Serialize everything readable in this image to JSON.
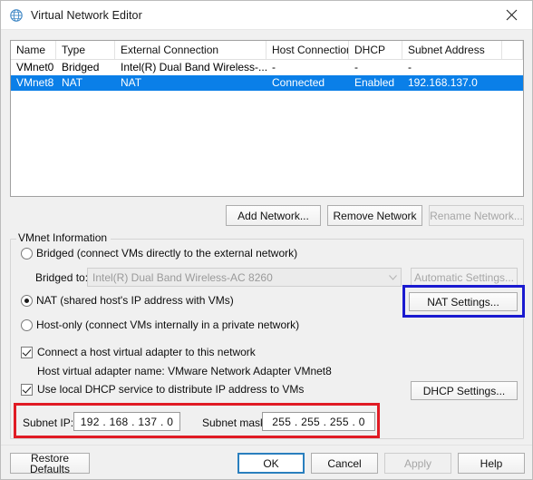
{
  "window": {
    "title": "Virtual Network Editor",
    "icon": "network-globe-icon",
    "close_label": "✕"
  },
  "network_list": {
    "columns": [
      "Name",
      "Type",
      "External Connection",
      "Host Connection",
      "DHCP",
      "Subnet Address"
    ],
    "rows": [
      {
        "name": "VMnet0",
        "type": "Bridged",
        "external": "Intel(R) Dual Band Wireless-...",
        "host": "-",
        "dhcp": "-",
        "subnet": "-",
        "selected": false
      },
      {
        "name": "VMnet8",
        "type": "NAT",
        "external": "NAT",
        "host": "Connected",
        "dhcp": "Enabled",
        "subnet": "192.168.137.0",
        "selected": true
      }
    ],
    "selection_color": "#0a7fe8"
  },
  "list_buttons": {
    "add": "Add Network...",
    "remove": "Remove Network",
    "rename": "Rename Network..."
  },
  "vmnet_info": {
    "group_title": "VMnet Information",
    "bridged_option": "Bridged (connect VMs directly to the external network)",
    "bridged_to_label": "Bridged to:",
    "bridged_to_value": "Intel(R) Dual Band Wireless-AC 8260",
    "automatic_settings": "Automatic Settings...",
    "nat_option": "NAT (shared host's IP address with VMs)",
    "nat_settings": "NAT Settings...",
    "hostonly_option": "Host-only (connect VMs internally in a private network)",
    "connect_adapter": "Connect a host virtual adapter to this network",
    "adapter_name": "Host virtual adapter name: VMware Network Adapter VMnet8",
    "local_dhcp": "Use local DHCP service to distribute IP address to VMs",
    "dhcp_settings": "DHCP Settings...",
    "subnet_ip_label": "Subnet IP:",
    "subnet_ip_value": "192 . 168 . 137 .  0",
    "subnet_mask_label": "Subnet mask:",
    "subnet_mask_value": "255 . 255 . 255 .  0"
  },
  "highlights": {
    "nat_settings_box_color": "#1a1ad0",
    "subnet_box_color": "#e01b24"
  },
  "footer": {
    "restore_defaults": "Restore Defaults",
    "ok": "OK",
    "cancel": "Cancel",
    "apply": "Apply",
    "help": "Help"
  }
}
